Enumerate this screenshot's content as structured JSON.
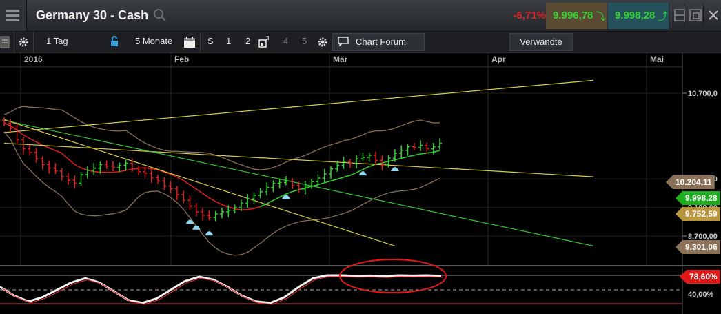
{
  "header": {
    "title": "Germany 30 - Cash",
    "change": "-6,71%",
    "bid": "9.996,78",
    "ask": "9.998,28"
  },
  "toolbar": {
    "interval": "1 Tag",
    "range": "5 Monate",
    "s_label": "S",
    "num1": "1",
    "num2": "2",
    "num4": "4",
    "num5": "5",
    "forum": "Chart Forum",
    "related": "Verwandte"
  },
  "colors": {
    "up": "#2fd22f",
    "down": "#e02020",
    "bollinger": "#8a7158",
    "ma": "#e02020",
    "trend_yellow": "#d8cf4a",
    "trend_green": "#36c236"
  },
  "chart_data": [
    {
      "type": "candlestick",
      "x_ticks": [
        "2016",
        "Feb",
        "Mär",
        "Apr",
        "Mai"
      ],
      "y_ticks": [
        "10.700,0",
        "9.500,00",
        "9.100,00",
        "8.700,00"
      ],
      "price_labels": {
        "upper_band": "10.204,11",
        "current": "9.998,28",
        "level": "9.752,59",
        "lower_band": "9.301,06"
      },
      "approx_closes": [
        10280,
        10210,
        10050,
        9920,
        9870,
        9780,
        9700,
        9650,
        9610,
        9530,
        9480,
        9440,
        9560,
        9620,
        9650,
        9700,
        9680,
        9660,
        9690,
        9720,
        9640,
        9600,
        9580,
        9520,
        9470,
        9400,
        9360,
        9280,
        9200,
        9120,
        9040,
        8990,
        8960,
        9010,
        9040,
        9060,
        9100,
        9160,
        9220,
        9270,
        9320,
        9380,
        9440,
        9450,
        9470,
        9410,
        9360,
        9400,
        9460,
        9510,
        9570,
        9640,
        9690,
        9740,
        9720,
        9780,
        9800,
        9830,
        9760,
        9700,
        9790,
        9860,
        9900,
        9950,
        9940,
        9970,
        9920,
        9950,
        10000
      ]
    },
    {
      "type": "line",
      "name": "",
      "y_ticks": [
        "40,00%"
      ],
      "current_label": "78,60%"
    }
  ]
}
